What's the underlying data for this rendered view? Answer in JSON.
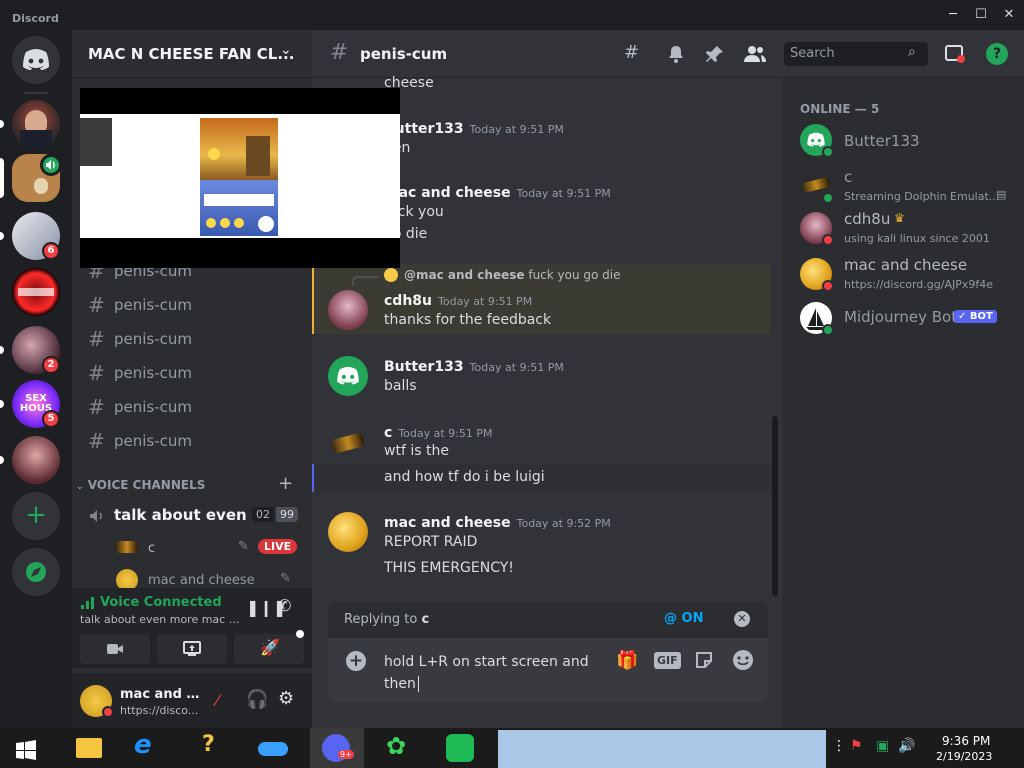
{
  "window": {
    "brand": "Discord",
    "minimize": "─",
    "maximize": "☐",
    "close": "✕"
  },
  "guild": {
    "name": "MAC N CHEESE FAN CL...",
    "chevron": "⌄"
  },
  "channels": [
    {
      "name": "penis-cum"
    },
    {
      "name": "penis-cum"
    },
    {
      "name": "penis-cum"
    },
    {
      "name": "penis-cum"
    },
    {
      "name": "penis-cum"
    },
    {
      "name": "penis-cum"
    }
  ],
  "voice_section": {
    "label": "VOICE CHANNELS",
    "add": "+"
  },
  "voice_channel": {
    "name": "talk about even ...",
    "count_a": "02",
    "count_b": "99",
    "users": [
      {
        "name": "c",
        "live": "LIVE"
      },
      {
        "name": "mac and cheese"
      }
    ]
  },
  "servers": [
    {
      "badge": ""
    },
    {
      "badge": ""
    },
    {
      "badge": "6"
    },
    {
      "badge": ""
    },
    {
      "badge": "2"
    },
    {
      "badge": "5"
    },
    {
      "badge": ""
    }
  ],
  "voice_panel": {
    "status": "Voice Connected",
    "sub": "talk about even more mac a..."
  },
  "user_panel": {
    "name": "mac and c...",
    "sub": "https://disco..."
  },
  "header": {
    "channel": "penis-cum",
    "search_placeholder": "Search"
  },
  "messages": {
    "top_text": "cheese",
    "m1": {
      "author": "Butter133",
      "time": "Today at 9:51 PM",
      "text": "hen"
    },
    "m2": {
      "author": "mac and cheese",
      "time": "Today at 9:51 PM",
      "lines": [
        "fuck you",
        "go die"
      ]
    },
    "m3": {
      "reply_author": "@mac and cheese",
      "reply_text": "fuck you go die",
      "author": "cdh8u",
      "time": "Today at 9:51 PM",
      "text": "thanks for the feedback"
    },
    "m4": {
      "author": "Butter133",
      "time": "Today at 9:51 PM",
      "text": "balls"
    },
    "m5": {
      "author": "c",
      "time": "Today at 9:51 PM",
      "lines": [
        "wtf is the",
        "and how tf do i be luigi"
      ]
    },
    "m6": {
      "author": "mac and cheese",
      "time": "Today at 9:52 PM",
      "lines": [
        "REPORT RAID",
        "THIS EMERGENCY!"
      ]
    }
  },
  "composer": {
    "replying_prefix": "Replying to",
    "replying_to": "c",
    "mention": "@ ON",
    "text_line1": "hold L+R on start screen and",
    "text_line2": "then",
    "gif": "GIF"
  },
  "members": {
    "heading": "ONLINE — 5",
    "list": [
      {
        "name": "Butter133",
        "status": ""
      },
      {
        "name": "c",
        "status": "Streaming Dolphin Emulat..."
      },
      {
        "name": "cdh8u",
        "status": "using kali linux since 2001"
      },
      {
        "name": "mac and cheese",
        "status": "https://discord.gg/AJPx9f4e"
      },
      {
        "name": "Midjourney Bot",
        "status": "",
        "tag": "✓ BOT"
      }
    ]
  },
  "taskbar": {
    "time": "9:36 PM",
    "date": "2/19/2023",
    "discord_badge": "9+"
  },
  "colors": {
    "blurple": "#5865f2",
    "green": "#23a55a",
    "red": "#f23f43",
    "yellow": "#f0b232"
  }
}
